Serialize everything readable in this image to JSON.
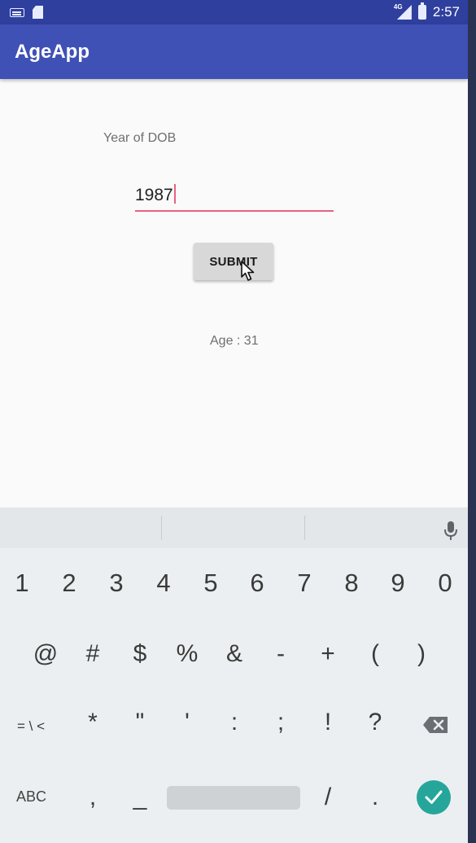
{
  "status_bar": {
    "time": "2:57",
    "network": "4G"
  },
  "app_bar": {
    "title": "AgeApp"
  },
  "form": {
    "dob_label": "Year of DOB",
    "dob_value": "1987",
    "submit_label": "SUBMIT",
    "age_result": "Age : 31"
  },
  "keyboard": {
    "digits": [
      "1",
      "2",
      "3",
      "4",
      "5",
      "6",
      "7",
      "8",
      "9",
      "0"
    ],
    "symbols": [
      "@",
      "#",
      "$",
      "%",
      "&",
      "-",
      "+",
      "(",
      ")"
    ],
    "row3": [
      "= \\ <",
      "*",
      "\"",
      "'",
      ":",
      ";",
      "!",
      "?"
    ],
    "bottom": {
      "abc": "ABC",
      "comma": ",",
      "underscore": "_",
      "slash": "/",
      "period": "."
    },
    "accent_color": "#26a69a"
  },
  "colors": {
    "app_bar": "#3f51b5",
    "status_bar": "#2f3f9e",
    "field_underline": "#e8607e"
  }
}
